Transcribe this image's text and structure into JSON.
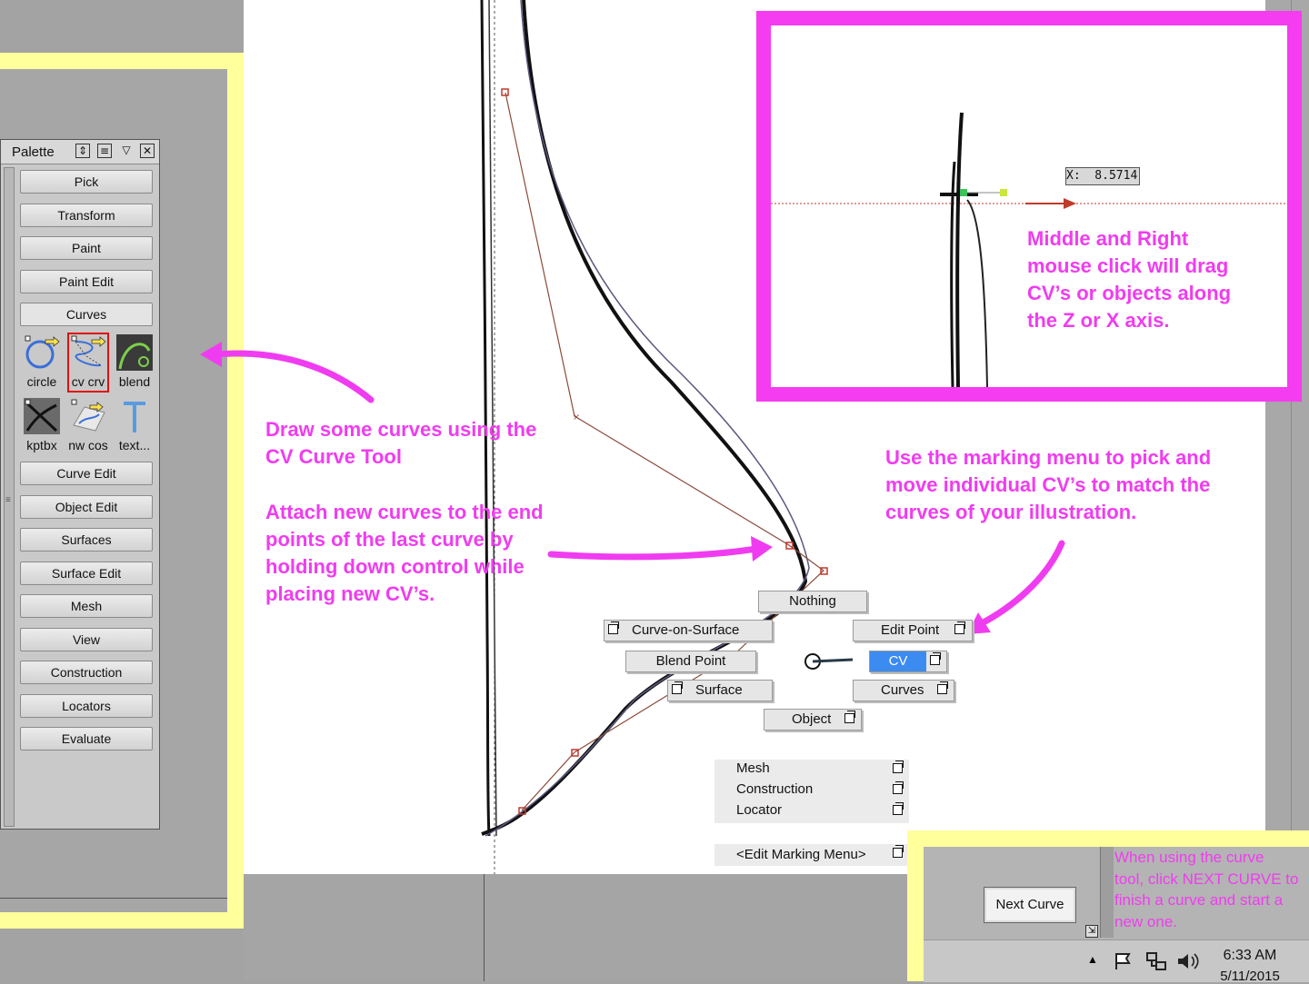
{
  "palette": {
    "title": "Palette",
    "buttons_top": [
      "Pick",
      "Transform",
      "Paint",
      "Paint Edit"
    ],
    "curves_tab": "Curves",
    "tools": [
      {
        "label": "circle",
        "icon": "circle-icon"
      },
      {
        "label": "cv crv",
        "icon": "cv-curve-icon"
      },
      {
        "label": "blend",
        "icon": "blend-icon"
      },
      {
        "label": "kptbx",
        "icon": "keypoint-toolbox-icon"
      },
      {
        "label": "nw cos",
        "icon": "new-cos-icon"
      },
      {
        "label": "text...",
        "icon": "text-icon"
      }
    ],
    "buttons_bottom": [
      "Curve Edit",
      "Object Edit",
      "Surfaces",
      "Surface Edit",
      "Mesh",
      "View",
      "Construction",
      "Locators",
      "Evaluate"
    ]
  },
  "notes": {
    "draw_line1": "Draw some curves using the",
    "draw_line2": "CV Curve Tool",
    "attach_line1": "Attach new curves to the end",
    "attach_line2": "points of the last curve by",
    "attach_line3": "holding down control while",
    "attach_line4": "placing new CV’s.",
    "marking_line1": "Use the marking menu to pick and",
    "marking_line2": "move individual CV’s to match the",
    "marking_line3": "curves of your illustration.",
    "drag_line1": "Middle and Right",
    "drag_line2": "mouse click will drag",
    "drag_line3": "CV’s or objects along",
    "drag_line4": "the Z or X axis.",
    "next_line1": "When using the curve",
    "next_line2": "tool, click NEXT CURVE to",
    "next_line3": "finish a curve and start a",
    "next_line4": "new one."
  },
  "inset": {
    "x_readout": "X:  8.5714"
  },
  "marking_menu": {
    "nothing": "Nothing",
    "curve_on_surface": "Curve-on-Surface",
    "edit_point": "Edit Point",
    "blend_point": "Blend Point",
    "cv": "CV",
    "surface": "Surface",
    "curves": "Curves",
    "object": "Object",
    "sub_items": [
      "Mesh",
      "Construction",
      "Locator"
    ],
    "edit_marking_menu": "<Edit Marking Menu>"
  },
  "next_curve_button": "Next Curve",
  "taskbar": {
    "time": "6:33 AM",
    "date": "5/11/2015"
  },
  "colors": {
    "magenta": "#f03cf0",
    "highlight_yellow": "#ffff9c",
    "selected_blue": "#3b8bf0",
    "tool_selected_red": "#e01010"
  }
}
